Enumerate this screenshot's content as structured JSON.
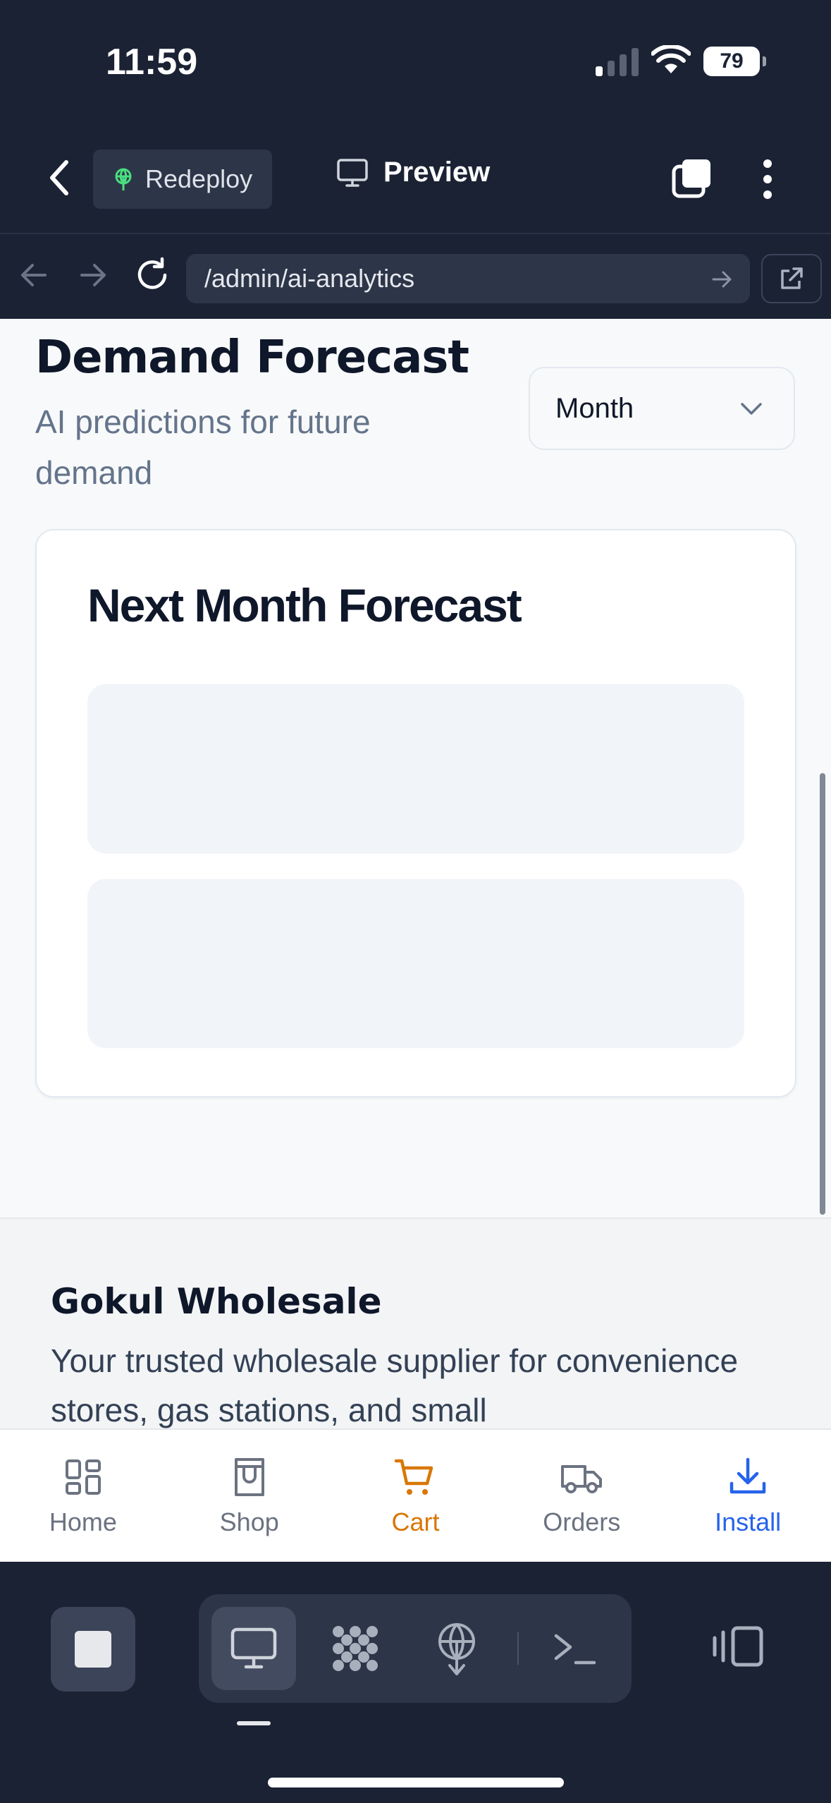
{
  "status_bar": {
    "time": "11:59",
    "battery": "79"
  },
  "header": {
    "redeploy_label": "Redeploy",
    "preview_label": "Preview"
  },
  "browser": {
    "url": "/admin/ai-analytics"
  },
  "page": {
    "title": "Demand Forecast",
    "subtitle": "AI predictions for future demand",
    "period_select": {
      "value": "Month"
    },
    "forecast_card": {
      "title": "Next Month Forecast"
    }
  },
  "footer": {
    "name": "Gokul Wholesale",
    "tagline": "Your trusted wholesale supplier for convenience stores, gas stations, and small"
  },
  "bottom_nav": [
    {
      "label": "Home",
      "icon": "grid-icon"
    },
    {
      "label": "Shop",
      "icon": "shop-icon"
    },
    {
      "label": "Cart",
      "icon": "cart-icon",
      "active": true
    },
    {
      "label": "Orders",
      "icon": "truck-icon"
    },
    {
      "label": "Install",
      "icon": "download-icon"
    }
  ],
  "colors": {
    "chrome": "#1b2234",
    "active_nav": "#d97706",
    "install": "#2563eb",
    "redeploy_icon": "#4ade80"
  }
}
